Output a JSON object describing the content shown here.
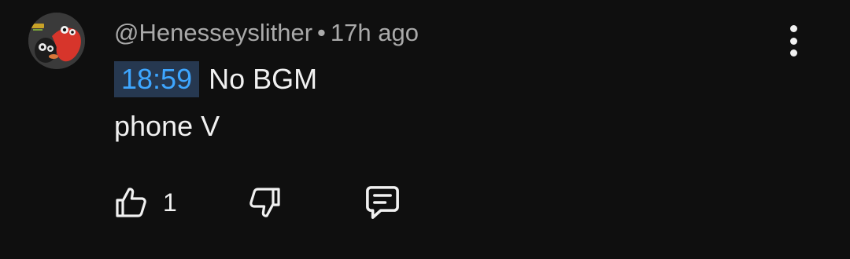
{
  "comment": {
    "author": "@Henesseyslither",
    "separator": "•",
    "time_ago": "17h ago",
    "timestamp_link": "18:59",
    "line1_text": "No BGM",
    "line2_text": "phone V",
    "like_count": "1"
  },
  "icons": {
    "avatar": "avatar-image",
    "more": "more-vert-icon",
    "like": "thumb-up-icon",
    "dislike": "thumb-down-icon",
    "reply": "reply-comment-icon"
  },
  "colors": {
    "background": "#0f0f0f",
    "text_primary": "#f1f1f1",
    "text_secondary": "#aaaaaa",
    "timestamp_link": "#3ea6ff",
    "timestamp_bg": "#263850"
  }
}
